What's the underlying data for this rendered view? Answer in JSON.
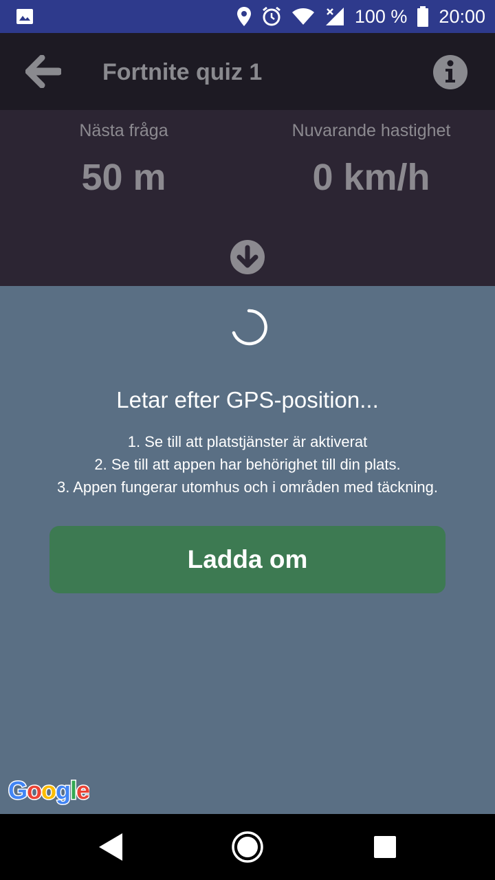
{
  "status_bar": {
    "battery_percent": "100 %",
    "time": "20:00",
    "icons": [
      "image-icon",
      "location-icon",
      "alarm-icon",
      "wifi-icon",
      "cellular-icon",
      "battery-icon"
    ]
  },
  "app_bar": {
    "title": "Fortnite quiz 1",
    "back_icon": "arrow-left-icon",
    "info_icon": "info-icon"
  },
  "stats": {
    "next_question_label": "Nästa fråga",
    "next_question_value": "50 m",
    "speed_label": "Nuvarande hastighet",
    "speed_value": "0 km/h"
  },
  "main": {
    "searching_text": "Letar efter GPS-position...",
    "instruction_1": "1. Se till att platstjänster är aktiverat",
    "instruction_2": "2. Se till att appen har behörighet till din plats.",
    "instruction_3": "3. Appen fungerar utomhus och i områden med täckning.",
    "reload_label": "Ladda om"
  },
  "map_attribution": "Google",
  "colors": {
    "status_bar": "#2e3a8c",
    "app_bar": "#1d1a23",
    "stats_panel": "#2c2533",
    "overlay": "#5a6f84",
    "reload_button": "#3d7a52"
  }
}
